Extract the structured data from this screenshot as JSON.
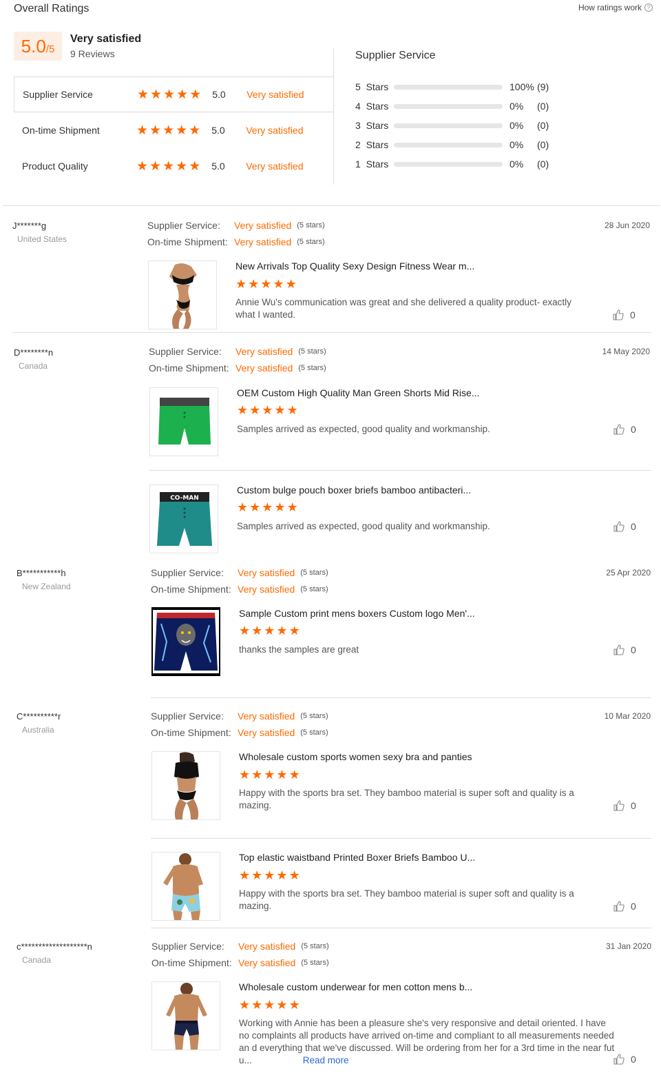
{
  "header": {
    "title": "Overall Ratings",
    "how_link": "How ratings work",
    "score": "5.0",
    "score_den": "/5",
    "summary_label": "Very satisfied",
    "review_count": "9 Reviews"
  },
  "dimensions": [
    {
      "name": "Supplier Service",
      "score": "5.0",
      "label": "Very satisfied",
      "stars": 5
    },
    {
      "name": "On-time Shipment",
      "score": "5.0",
      "label": "Very satisfied",
      "stars": 5
    },
    {
      "name": "Product Quality",
      "score": "5.0",
      "label": "Very satisfied",
      "stars": 5
    }
  ],
  "breakdown": {
    "title": "Supplier Service",
    "rows": [
      {
        "label": "5  Stars",
        "pct": "100%",
        "count": "(9)",
        "fraction": 1.0
      },
      {
        "label": "4  Stars",
        "pct": "0%",
        "count": "(0)",
        "fraction": 0
      },
      {
        "label": "3  Stars",
        "pct": "0%",
        "count": "(0)",
        "fraction": 0
      },
      {
        "label": "2  Stars",
        "pct": "0%",
        "count": "(0)",
        "fraction": 0
      },
      {
        "label": "1  Stars",
        "pct": "0%",
        "count": "(0)",
        "fraction": 0
      }
    ]
  },
  "meta_labels": {
    "service": "Supplier Service:",
    "shipment": "On-time Shipment:",
    "value": "Very satisfied",
    "stars_note": "(5 stars)"
  },
  "reviews": [
    {
      "reviewer": "J*******g",
      "country": "United States",
      "date": "28 Jun 2020",
      "products": [
        {
          "title": "New Arrivals Top Quality Sexy Design Fitness Wear m...",
          "comment": "Annie Wu's communication was great and she delivered a quality product- exactly what I wanted.",
          "likes": "0",
          "image": "woman-bikini-black"
        }
      ]
    },
    {
      "reviewer": "D********n",
      "country": "Canada",
      "date": "14 May 2020",
      "products": [
        {
          "title": "OEM Custom High Quality Man Green Shorts Mid Rise...",
          "comment": "Samples arrived as expected, good quality and workmanship.",
          "likes": "0",
          "image": "green-boxer"
        },
        {
          "title": "Custom bulge pouch boxer briefs bamboo antibacteri...",
          "comment": "Samples arrived as expected, good quality and workmanship.",
          "likes": "0",
          "image": "teal-boxer",
          "brand_text": "CO-MAN"
        }
      ]
    },
    {
      "reviewer": "B***********h",
      "country": "New Zealand",
      "date": "25 Apr 2020",
      "products": [
        {
          "title": "Sample Custom print mens boxers Custom logo Men'...",
          "comment": "thanks the samples are great",
          "likes": "0",
          "image": "wolf-print-boxer"
        }
      ]
    },
    {
      "reviewer": "C**********r",
      "country": "Australia",
      "date": "10 Mar 2020",
      "products": [
        {
          "title": "Wholesale custom sports women sexy bra and panties",
          "comment": "Happy with the sports bra set. They bamboo material is super soft and quality is a mazing.",
          "likes": "0",
          "image": "woman-sports-bra"
        },
        {
          "title": "Top elastic waistband Printed Boxer Briefs Bamboo U...",
          "comment": "Happy with the sports bra set. They bamboo material is super soft and quality is a mazing.",
          "likes": "0",
          "image": "man-printed-briefs"
        }
      ]
    },
    {
      "reviewer": "c*******************n",
      "country": "Canada",
      "date": "31 Jan 2020",
      "products": [
        {
          "title": "Wholesale custom underwear for men cotton mens b...",
          "comment": "Working with Annie has been a pleasure she's very responsive and detail oriented. I have no complaints all products have arrived on-time and compliant to all measurements needed an d everything that we've discussed. Will be ordering from her for a 3rd time in the near fut u...",
          "likes": "0",
          "image": "man-navy-trunks",
          "read_more": "Read more"
        }
      ]
    }
  ]
}
